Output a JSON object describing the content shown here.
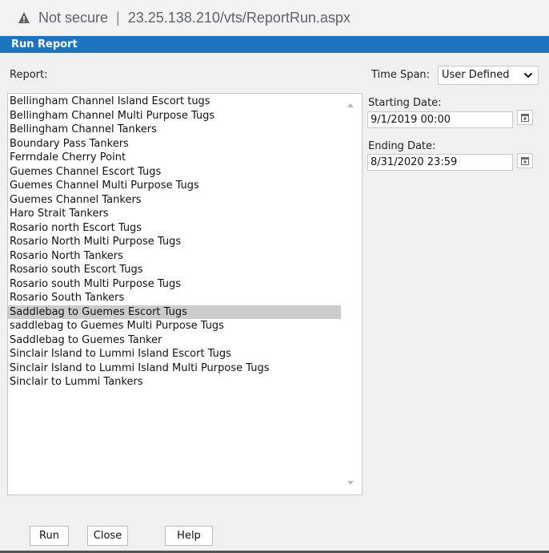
{
  "browser": {
    "security": "Not secure",
    "separator": "|",
    "url": "23.25.138.210/vts/ReportRun.aspx"
  },
  "dialog": {
    "title": "Run Report",
    "report_label": "Report:",
    "reports": [
      "Bellingham Channel Island Escort tugs",
      "Bellingham Channel Multi Purpose Tugs",
      "Bellingham Channel Tankers",
      "Boundary Pass Tankers",
      "Ferrndale Cherry Point",
      "Guemes Channel Escort Tugs",
      "Guemes Channel Multi Purpose Tugs",
      "Guemes Channel Tankers",
      "Haro Strait Tankers",
      "Rosario north Escort Tugs",
      "Rosario North Multi Purpose Tugs",
      "Rosario North Tankers",
      "Rosario south Escort Tugs",
      "Rosario south Multi Purpose Tugs",
      "Rosario South Tankers",
      "Saddlebag to Guemes Escort Tugs",
      "saddlebag to Guemes Multi Purpose Tugs",
      "Saddlebag to Guemes Tanker",
      "Sinclair Island to Lummi Island Escort Tugs",
      "Sinclair Island to Lummi Island Multi Purpose Tugs",
      "Sinclair to Lummi Tankers"
    ],
    "selected_report": "Saddlebag to Guemes Escort Tugs",
    "time_span_label": "Time Span:",
    "time_span_value": "User Defined",
    "starting_date_label": "Starting Date:",
    "starting_date_value": "9/1/2019 00:00",
    "ending_date_label": "Ending Date:",
    "ending_date_value": "8/31/2020 23:59",
    "buttons": {
      "run": "Run",
      "close": "Close",
      "help": "Help"
    }
  },
  "colors": {
    "title_bar": "#1e73be",
    "selected_row": "#cccccc",
    "warning": "#5f6368"
  },
  "icons": {
    "security": "warning-triangle-icon",
    "dropdown": "chevron-down-icon",
    "calendar": "calendar-icon"
  }
}
